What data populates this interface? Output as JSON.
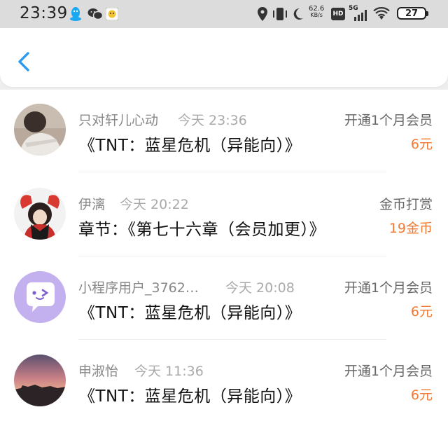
{
  "status_bar": {
    "time": "23:39",
    "net_speed_value": "62.6",
    "net_speed_unit": "KB/s",
    "hd_label": "HD",
    "network_label": "5G",
    "battery_level": "27",
    "icons": [
      "qq-icon",
      "wechat-icon",
      "app-badge-icon",
      "location-icon",
      "vibrate-icon",
      "moon-icon",
      "hd-icon",
      "signal-icon",
      "wifi-icon",
      "battery-icon"
    ]
  },
  "nav": {
    "back_icon": "chevron-left-icon",
    "accent_color": "#2f9bf0"
  },
  "colors": {
    "amount": "#f07a33",
    "name": "#888888",
    "time": "#aaaaaa",
    "content": "#111111"
  },
  "records": [
    {
      "name": "只对轩儿心动",
      "time": "今天 23:36",
      "content": "《TNT：蓝星危机（异能向）》",
      "action": "开通1个月会员",
      "amount": "6元"
    },
    {
      "name": "伊漓",
      "time": "今天 20:22",
      "content": "章节：《第七十六章（会员加更）》",
      "action": "金币打赏",
      "amount": "19金币"
    },
    {
      "name": "小程序用户_3762…",
      "time": "今天 20:08",
      "content": "《TNT：蓝星危机（异能向）》",
      "action": "开通1个月会员",
      "amount": "6元"
    },
    {
      "name": "申淑怡",
      "time": "今天 11:36",
      "content": "《TNT：蓝星危机（异能向）》",
      "action": "开通1个月会员",
      "amount": "6元"
    }
  ]
}
